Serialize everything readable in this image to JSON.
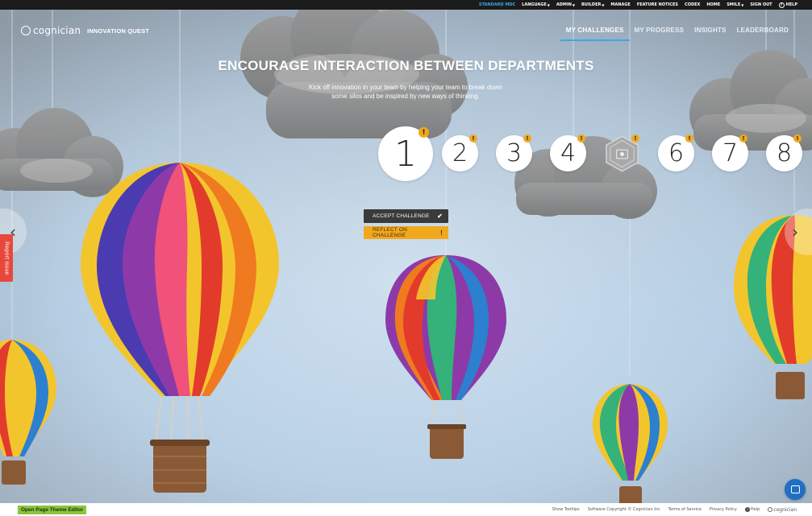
{
  "admin_bar": {
    "items": [
      {
        "label": "STANDARD MDC",
        "active": true,
        "dropdown": false
      },
      {
        "label": "LANGUAGE",
        "active": false,
        "dropdown": true
      },
      {
        "label": "ADMIN",
        "active": false,
        "dropdown": true
      },
      {
        "label": "BUILDER",
        "active": false,
        "dropdown": true
      },
      {
        "label": "MANAGE",
        "active": false,
        "dropdown": false
      },
      {
        "label": "FEATURE NOTICES",
        "active": false,
        "dropdown": false
      },
      {
        "label": "CODEX",
        "active": false,
        "dropdown": false
      },
      {
        "label": "HOME",
        "active": false,
        "dropdown": false
      },
      {
        "label": "SMILE",
        "active": false,
        "dropdown": true
      },
      {
        "label": "SIGN OUT",
        "active": false,
        "dropdown": false
      }
    ],
    "help_label": "HELP"
  },
  "header": {
    "logo_text": "cognician",
    "app_title": "INNOVATION QUEST",
    "tabs": [
      {
        "label": "MY CHALLENGES",
        "active": true
      },
      {
        "label": "MY PROGRESS",
        "active": false
      },
      {
        "label": "INSIGHTS",
        "active": false
      },
      {
        "label": "LEADERBOARD",
        "active": false
      }
    ]
  },
  "challenge": {
    "title": "ENCOURAGE INTERACTION BETWEEN DEPARTMENTS",
    "description": "Kick off innovation in your team by helping your team to break down some silos and be inspired by new ways of thinking.",
    "steps": [
      {
        "label": "1",
        "current": true,
        "alert": "!"
      },
      {
        "label": "2",
        "alert": "!"
      },
      {
        "label": "3",
        "alert": "!"
      },
      {
        "label": "4",
        "alert": "!"
      },
      {
        "label": "",
        "badge": true,
        "alert": "!"
      },
      {
        "label": "6",
        "alert": "!"
      },
      {
        "label": "7",
        "alert": "!"
      },
      {
        "label": "8",
        "alert": "!"
      }
    ],
    "accept_label": "ACCEPT CHALLENGE",
    "accept_icon": "check-icon",
    "reflect_label": "REFLECT ON CHALLENGE",
    "reflect_icon": "exclamation-icon"
  },
  "side": {
    "report_label": "Report issue",
    "prev_icon": "chevron-left-icon",
    "next_icon": "chevron-right-icon",
    "chat_icon": "chat-icon"
  },
  "footer": {
    "theme_editor_label": "Open Page Theme Editor",
    "show_tooltips": "Show Tooltips",
    "copyright": "Software Copyright © Cognician Inc",
    "terms": "Terms of Service",
    "privacy": "Privacy Policy",
    "help": "Help",
    "logo_text": "cognician"
  },
  "colors": {
    "accent_blue": "#3aa7e8",
    "alert_orange": "#f2a81d",
    "report_red": "#e8473b",
    "theme_green": "#8bc53f",
    "dark_button": "#3a3a3a"
  }
}
